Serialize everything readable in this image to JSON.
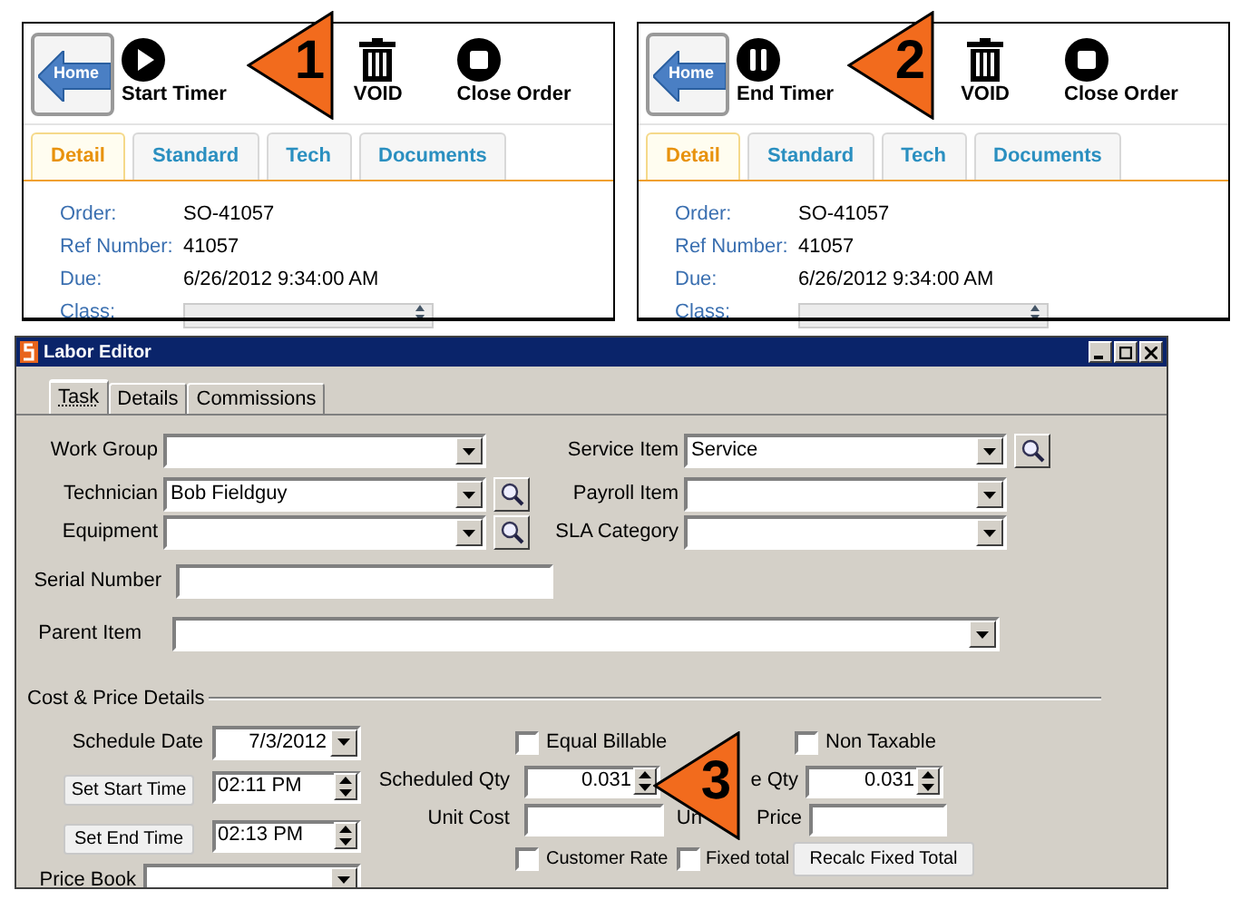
{
  "panels": [
    {
      "callout": "1",
      "home": "Home",
      "timer": {
        "kind": "start",
        "label": "Start Timer"
      },
      "void": "VOID",
      "close": "Close Order",
      "tabs": [
        {
          "label": "Detail",
          "selected": true
        },
        {
          "label": "Standard",
          "selected": false
        },
        {
          "label": "Tech",
          "selected": false
        },
        {
          "label": "Documents",
          "selected": false
        }
      ],
      "fields": [
        {
          "label": "Order:",
          "kind": "text",
          "value": "SO-41057"
        },
        {
          "label": "Ref Number:",
          "kind": "text",
          "value": "41057"
        },
        {
          "label": "Due:",
          "kind": "text",
          "value": "6/26/2012 9:34:00 AM"
        },
        {
          "label": "Class:",
          "kind": "select"
        }
      ]
    },
    {
      "callout": "2",
      "home": "Home",
      "timer": {
        "kind": "end",
        "label": "End Timer"
      },
      "void": "VOID",
      "close": "Close Order",
      "tabs": [
        {
          "label": "Detail",
          "selected": true
        },
        {
          "label": "Standard",
          "selected": false
        },
        {
          "label": "Tech",
          "selected": false
        },
        {
          "label": "Documents",
          "selected": false
        }
      ],
      "fields": [
        {
          "label": "Order:",
          "kind": "text",
          "value": "SO-41057"
        },
        {
          "label": "Ref Number:",
          "kind": "text",
          "value": "41057"
        },
        {
          "label": "Due:",
          "kind": "text",
          "value": "6/26/2012 9:34:00 AM"
        },
        {
          "label": "Class:",
          "kind": "select"
        }
      ]
    }
  ],
  "editor": {
    "title": "Labor Editor",
    "tabs": [
      {
        "label": "Task",
        "selected": true
      },
      {
        "label": "Details",
        "selected": false
      },
      {
        "label": "Commissions",
        "selected": false
      }
    ],
    "left_fields": [
      {
        "label": "Work Group",
        "lookup": false
      },
      {
        "label": "Technician",
        "value": "Bob Fieldguy",
        "lookup": true
      },
      {
        "label": "Equipment",
        "lookup": true
      }
    ],
    "right_fields": [
      {
        "label": "Service Item",
        "value": "Service",
        "lookup": true
      },
      {
        "label": "Payroll Item",
        "lookup": false
      },
      {
        "label": "SLA Category",
        "lookup": false
      }
    ],
    "serial_number": {
      "label": "Serial Number"
    },
    "parent_item": {
      "label": "Parent Item"
    },
    "cost": {
      "title": "Cost & Price Details",
      "callout": "3",
      "schedule_date": {
        "label": "Schedule Date",
        "value": "7/3/2012"
      },
      "start_time": {
        "button": "Set Start Time",
        "value": "02:11 PM"
      },
      "end_time": {
        "button": "Set End Time",
        "value": "02:13 PM"
      },
      "price_book": {
        "label": "Price Book"
      },
      "scheduled_qty": {
        "label": "Scheduled Qty",
        "value": "0.031"
      },
      "unit_cost": {
        "label": "Unit Cost"
      },
      "second_qty": {
        "label": "e Qty",
        "value": "0.031"
      },
      "unit_price": {
        "label_parts": [
          "Un",
          "Price"
        ]
      },
      "checkboxes": [
        {
          "label": "Equal Billable",
          "checked": false
        },
        {
          "label": "Non Taxable",
          "checked": false
        },
        {
          "label": "Customer Rate",
          "checked": false
        },
        {
          "label": "Fixed total",
          "checked": false
        }
      ],
      "recalc_button": "Recalc Fixed Total"
    }
  }
}
